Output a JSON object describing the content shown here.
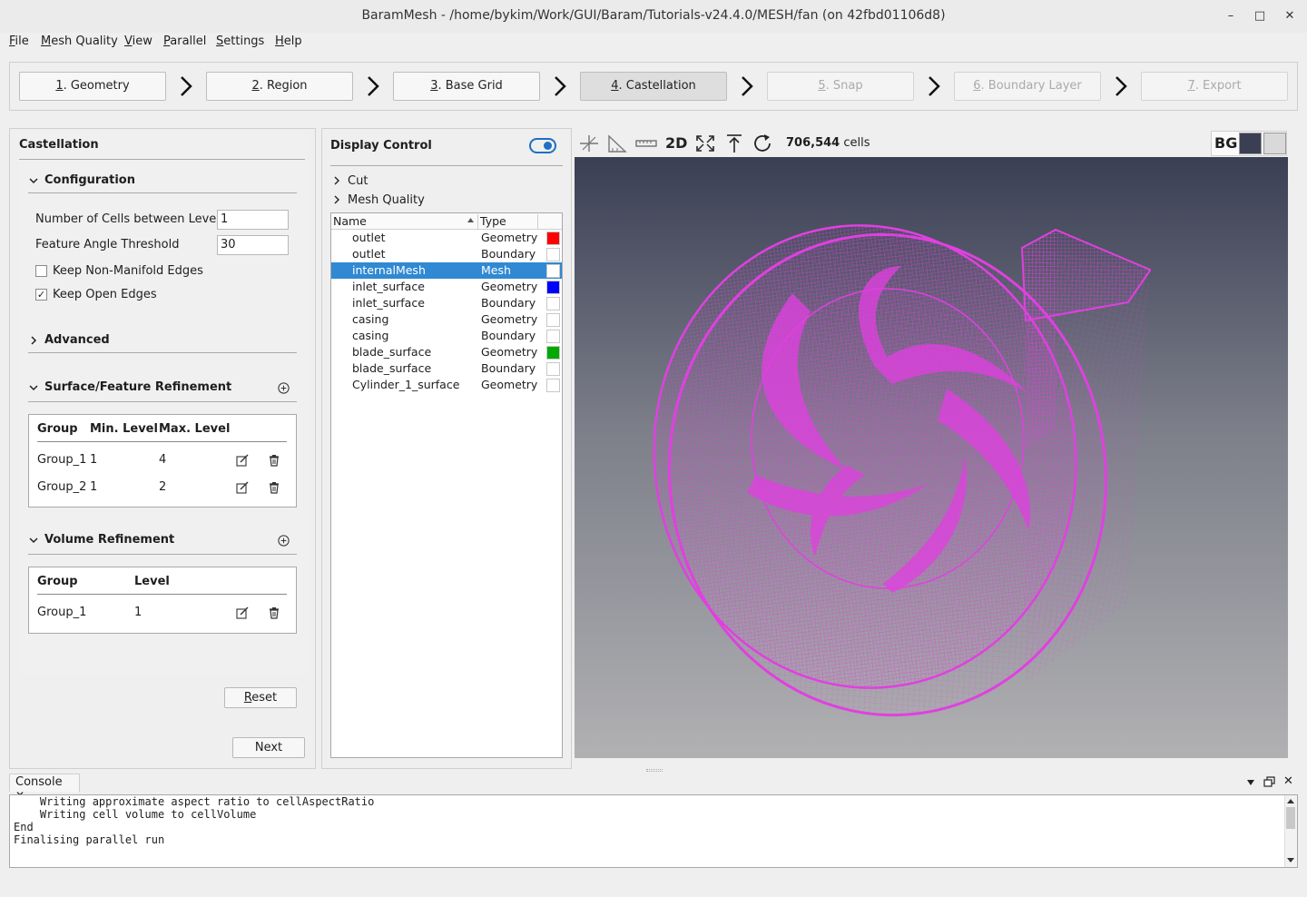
{
  "window": {
    "title": "BaramMesh - /home/bykim/Work/GUI/Baram/Tutorials-v24.4.0/MESH/fan (on 42fbd01106d8)",
    "minimize_icon": "minimize-icon",
    "maximize_icon": "maximize-icon",
    "close_icon": "close-icon"
  },
  "menu": {
    "items": [
      {
        "mnemonic": "F",
        "rest": "ile"
      },
      {
        "mnemonic": "M",
        "rest": "esh Quality"
      },
      {
        "mnemonic": "V",
        "rest": "iew"
      },
      {
        "mnemonic": "P",
        "rest": "arallel"
      },
      {
        "mnemonic": "S",
        "rest": "ettings"
      },
      {
        "mnemonic": "H",
        "rest": "elp"
      }
    ]
  },
  "steps": [
    {
      "num": "1",
      "label": ". Geometry",
      "state": "enabled"
    },
    {
      "num": "2",
      "label": ". Region",
      "state": "enabled"
    },
    {
      "num": "3",
      "label": ". Base Grid",
      "state": "enabled"
    },
    {
      "num": "4",
      "label": ". Castellation",
      "state": "active"
    },
    {
      "num": "5",
      "label": ". Snap",
      "state": "disabled"
    },
    {
      "num": "6",
      "label": ". Boundary Layer",
      "state": "disabled"
    },
    {
      "num": "7",
      "label": ". Export",
      "state": "disabled"
    }
  ],
  "castellation": {
    "title": "Castellation",
    "configuration": {
      "title": "Configuration",
      "cells_between_levels_label": "Number of Cells between Levels",
      "cells_between_levels_value": "1",
      "feature_angle_label": "Feature Angle Threshold",
      "feature_angle_value": "30",
      "keep_non_manifold_label": "Keep Non-Manifold Edges",
      "keep_non_manifold_checked": false,
      "keep_open_edges_label": "Keep Open Edges",
      "keep_open_edges_checked": true,
      "check_mark": "✓"
    },
    "advanced": {
      "title": "Advanced"
    },
    "surface_refinement": {
      "title": "Surface/Feature Refinement",
      "headers": {
        "group": "Group",
        "min": "Min. Level",
        "max": "Max. Level"
      },
      "rows": [
        {
          "group": "Group_1",
          "min": "1",
          "max": "4"
        },
        {
          "group": "Group_2",
          "min": "1",
          "max": "2"
        }
      ]
    },
    "volume_refinement": {
      "title": "Volume Refinement",
      "headers": {
        "group": "Group",
        "level": "Level"
      },
      "rows": [
        {
          "group": "Group_1",
          "level": "1"
        }
      ]
    },
    "reset_mnemonic": "R",
    "reset_rest": "eset",
    "next_label": "Next"
  },
  "display_control": {
    "title": "Display Control",
    "cut_label": "Cut",
    "mesh_quality_label": "Mesh Quality",
    "columns": {
      "name": "Name",
      "type": "Type"
    },
    "rows": [
      {
        "name": "outlet",
        "type": "Geometry",
        "color": "#ff0000",
        "selected": false
      },
      {
        "name": "outlet",
        "type": "Boundary",
        "color": "#ffffff",
        "selected": false
      },
      {
        "name": "internalMesh",
        "type": "Mesh",
        "color": "#ffffff",
        "selected": true
      },
      {
        "name": "inlet_surface",
        "type": "Geometry",
        "color": "#0000ff",
        "selected": false
      },
      {
        "name": "inlet_surface",
        "type": "Boundary",
        "color": "#ffffff",
        "selected": false
      },
      {
        "name": "casing",
        "type": "Geometry",
        "color": "#ffffff",
        "selected": false
      },
      {
        "name": "casing",
        "type": "Boundary",
        "color": "#ffffff",
        "selected": false
      },
      {
        "name": "blade_surface",
        "type": "Geometry",
        "color": "#00aa00",
        "selected": false
      },
      {
        "name": "blade_surface",
        "type": "Boundary",
        "color": "#ffffff",
        "selected": false
      },
      {
        "name": "Cylinder_1_surface",
        "type": "Geometry",
        "color": "#ffffff",
        "selected": false
      }
    ]
  },
  "viewer": {
    "two_d_label": "2D",
    "cell_count": "706,544",
    "cell_unit": "cells",
    "bg_label": "BG",
    "bg_dark_color": "#3a3f54",
    "bg_light_color": "#d9d9d9",
    "mesh_color": "#e040e0"
  },
  "console": {
    "tab_label": "Console",
    "lines": "    Writing approximate aspect ratio to cellAspectRatio\n    Writing cell volume to cellVolume\nEnd\nFinalising parallel run"
  }
}
